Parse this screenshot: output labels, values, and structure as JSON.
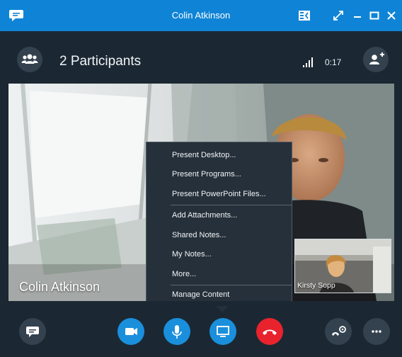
{
  "window": {
    "title": "Colin Atkinson"
  },
  "header": {
    "participants_label": "2 Participants",
    "call_timer": "0:17"
  },
  "video": {
    "remote_name": "Colin Atkinson",
    "self_name": "Kirsty Sopp"
  },
  "share_menu": {
    "items": [
      {
        "label": "Present Desktop..."
      },
      {
        "label": "Present Programs..."
      },
      {
        "label": "Present PowerPoint Files..."
      },
      {
        "label": "Add Attachments..."
      },
      {
        "label": "Shared Notes..."
      },
      {
        "label": "My Notes..."
      },
      {
        "label": "More..."
      },
      {
        "label": "Manage Content"
      }
    ]
  },
  "colors": {
    "titlebar": "#0f84d6",
    "background": "#1b2833",
    "control_blue": "#1a8fdc",
    "hangup_red": "#e8232d",
    "round_button_gray": "#34424f"
  },
  "icons": {
    "app": "skype-chat-bubble-icon",
    "participants": "people-icon",
    "add_person": "add-person-icon",
    "signal": "signal-bars-icon",
    "chat": "chat-icon",
    "video": "video-camera-icon",
    "mic": "microphone-icon",
    "share": "screen-share-icon",
    "hangup": "hang-up-icon",
    "call_controls": "call-controls-icon",
    "more": "more-icon"
  }
}
